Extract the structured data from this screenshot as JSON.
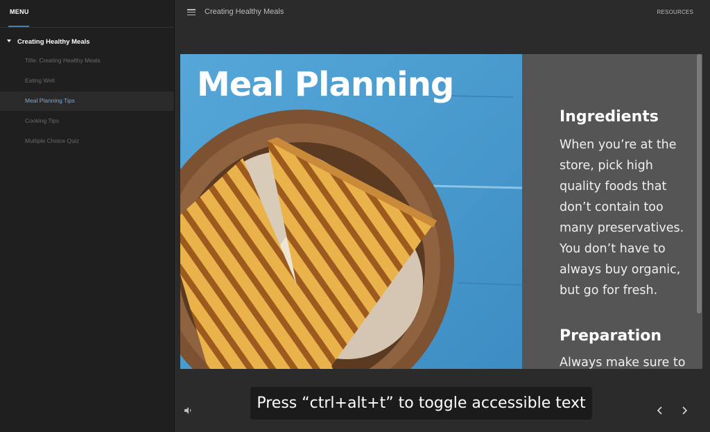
{
  "sidebar": {
    "menu_label": "MENU",
    "course_title": "Creating Healthy Meals",
    "items": [
      {
        "label": "Title: Creating Healthy Meals"
      },
      {
        "label": "Eating Well"
      },
      {
        "label": "Meal Planning Tips"
      },
      {
        "label": "Cooking Tips"
      },
      {
        "label": "Multiple Choice Quiz"
      }
    ],
    "active_index": 2
  },
  "topbar": {
    "title": "Creating Healthy Meals",
    "resources_label": "RESOURCES",
    "menu_icon": "hamburger-icon"
  },
  "slide": {
    "title": "Meal Planning",
    "sections": [
      {
        "heading": "Ingredients",
        "body": "When you’re at the store, pick high quality foods that don’t contain too many preservatives. You don’t have to always buy organic, but go for fresh."
      },
      {
        "heading": "Preparation",
        "body": "Always make sure to"
      }
    ]
  },
  "toast": {
    "text": "Press “ctrl+alt+t” to toggle accessible text"
  },
  "controls": {
    "volume_icon": "volume-icon",
    "prev_icon": "chevron-left-icon",
    "next_icon": "chevron-right-icon"
  },
  "colors": {
    "sidebar_bg": "#1f1f1f",
    "content_bg": "#2b2b2b",
    "accent": "#7fa9d4",
    "slide_panel": "#555555"
  }
}
